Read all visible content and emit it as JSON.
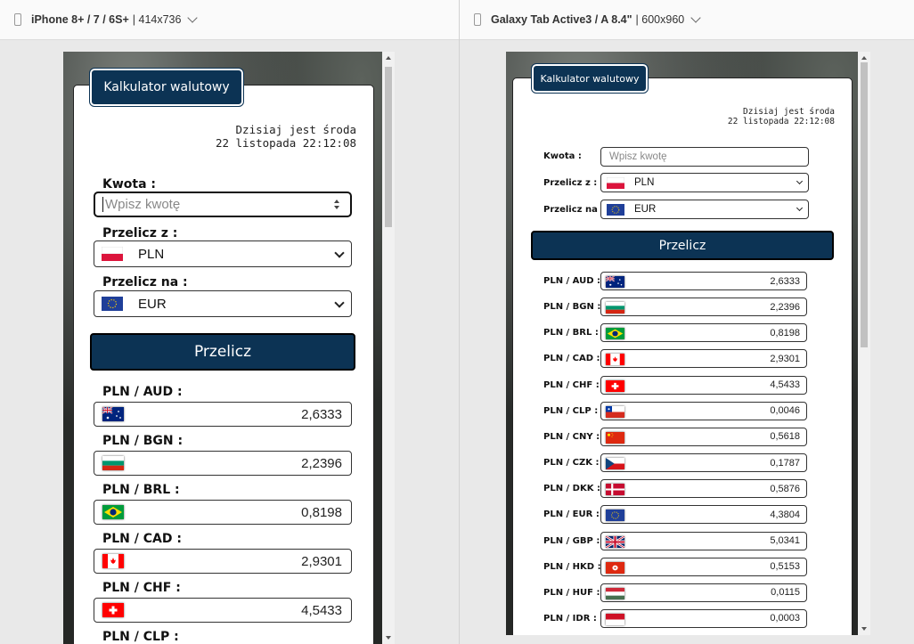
{
  "left": {
    "device": "iPhone 8+ / 7 / 6S+",
    "size": "| 414x736",
    "tab": "Kalkulator walutowy",
    "date_line1": "Dzisiaj jest środa",
    "date_line2": "22 listopada 22:12:08",
    "amount_label": "Kwota :",
    "amount_placeholder": "Wpisz kwotę",
    "from_label": "Przelicz z :",
    "from_value": "PLN",
    "to_label": "Przelicz na :",
    "to_value": "EUR",
    "button": "Przelicz",
    "rates": [
      {
        "pair": "PLN / AUD :",
        "value": "2,6333",
        "flag": "aud"
      },
      {
        "pair": "PLN / BGN :",
        "value": "2,2396",
        "flag": "bgn"
      },
      {
        "pair": "PLN / BRL :",
        "value": "0,8198",
        "flag": "brl"
      },
      {
        "pair": "PLN / CAD :",
        "value": "2,9301",
        "flag": "cad"
      },
      {
        "pair": "PLN / CHF :",
        "value": "4,5433",
        "flag": "chf"
      },
      {
        "pair": "PLN / CLP :",
        "value": "",
        "flag": "clp"
      }
    ]
  },
  "right": {
    "device": "Galaxy Tab Active3 / A 8.4\"",
    "size": "| 600x960",
    "tab": "Kalkulator walutowy",
    "date_line1": "Dzisiaj jest środa",
    "date_line2": "22 listopada 22:12:08",
    "amount_label": "Kwota :",
    "amount_placeholder": "Wpisz kwotę",
    "from_label": "Przelicz z :",
    "from_value": "PLN",
    "to_label": "Przelicz na :",
    "to_value": "EUR",
    "button": "Przelicz",
    "rates": [
      {
        "pair": "PLN / AUD :",
        "value": "2,6333",
        "flag": "aud"
      },
      {
        "pair": "PLN / BGN :",
        "value": "2,2396",
        "flag": "bgn"
      },
      {
        "pair": "PLN / BRL :",
        "value": "0,8198",
        "flag": "brl"
      },
      {
        "pair": "PLN / CAD :",
        "value": "2,9301",
        "flag": "cad"
      },
      {
        "pair": "PLN / CHF :",
        "value": "4,5433",
        "flag": "chf"
      },
      {
        "pair": "PLN / CLP :",
        "value": "0,0046",
        "flag": "clp"
      },
      {
        "pair": "PLN / CNY :",
        "value": "0,5618",
        "flag": "cny"
      },
      {
        "pair": "PLN / CZK :",
        "value": "0,1787",
        "flag": "czk"
      },
      {
        "pair": "PLN / DKK :",
        "value": "0,5876",
        "flag": "dkk"
      },
      {
        "pair": "PLN / EUR :",
        "value": "4,3804",
        "flag": "eur"
      },
      {
        "pair": "PLN / GBP :",
        "value": "5,0341",
        "flag": "gbp"
      },
      {
        "pair": "PLN / HKD :",
        "value": "0,5153",
        "flag": "hkd"
      },
      {
        "pair": "PLN / HUF :",
        "value": "0,0115",
        "flag": "huf"
      },
      {
        "pair": "PLN / IDR :",
        "value": "0,0003",
        "flag": "idr"
      }
    ]
  }
}
